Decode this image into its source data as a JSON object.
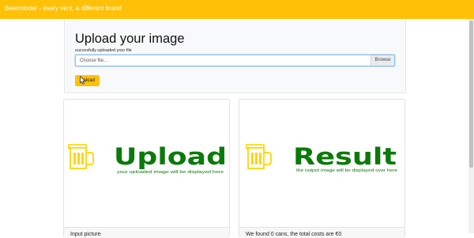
{
  "navbar": {
    "brand": "Beerminder - every vent, a different brand"
  },
  "upload_section": {
    "title": "Upload your image",
    "status": "succesfully uploaded your file",
    "file_input": {
      "placeholder": "Choose file...",
      "browse_label": "Browse"
    },
    "upload_button_label": "Upload"
  },
  "cards": [
    {
      "image_heading": "Upload",
      "image_subtitle": "your uploaded image will be displayed here",
      "caption": "Input picture"
    },
    {
      "image_heading": "Result",
      "image_subtitle": "the output image will be displayed over here",
      "caption": "We found 0 cans, the total costs are €0"
    }
  ],
  "colors": {
    "navbar": "#ffc107",
    "button": "#ffc107",
    "logo_green": "#0a7a0a",
    "logo_yellow": "#ffd600"
  },
  "icons": {
    "card_logo": "beer-mug-icon",
    "cursor": "mouse-pointer-icon"
  }
}
